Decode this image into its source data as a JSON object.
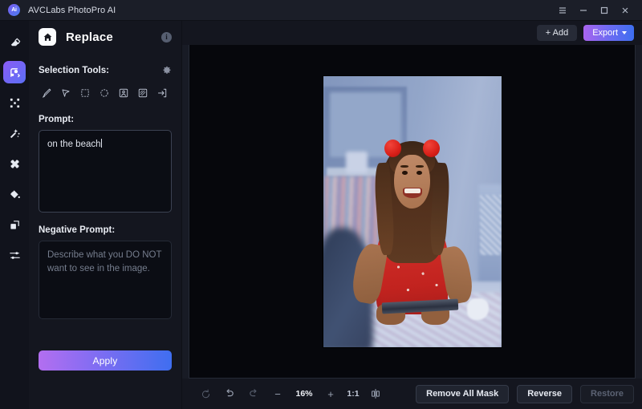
{
  "window": {
    "app_title": "AVCLabs PhotoPro AI",
    "logo_text": "Ai",
    "controls": [
      {
        "name": "menu",
        "glyph": "menu-icon"
      },
      {
        "name": "minimize",
        "glyph": "minimize-icon"
      },
      {
        "name": "maximize",
        "glyph": "maximize-icon"
      },
      {
        "name": "close",
        "glyph": "close-icon"
      }
    ]
  },
  "rail": {
    "items": [
      {
        "name": "eraser-tool",
        "icon": "eraser-icon",
        "active": false
      },
      {
        "name": "replace-tool",
        "icon": "replace-icon",
        "active": true
      },
      {
        "name": "expand-tool",
        "icon": "expand-icon",
        "active": false
      },
      {
        "name": "enhance-tool",
        "icon": "magic-wand-icon",
        "active": false
      },
      {
        "name": "retouch-tool",
        "icon": "retouch-icon",
        "active": false
      },
      {
        "name": "colorize-tool",
        "icon": "paint-bucket-icon",
        "active": false
      },
      {
        "name": "resize-tool",
        "icon": "resize-icon",
        "active": false
      },
      {
        "name": "adjust-tool",
        "icon": "sliders-icon",
        "active": false
      }
    ]
  },
  "panel": {
    "title": "Replace",
    "home_icon": "home-icon",
    "info_icon": "info-icon",
    "info_char": "i",
    "selection_tools_label": "Selection Tools:",
    "gear_icon": "gear-icon",
    "tools": [
      {
        "name": "brush-tool",
        "icon": "brush-icon"
      },
      {
        "name": "lasso-pointer-tool",
        "icon": "pointer-icon"
      },
      {
        "name": "rectangle-select-tool",
        "icon": "rectangle-select-icon"
      },
      {
        "name": "ellipse-select-tool",
        "icon": "ellipse-select-icon"
      },
      {
        "name": "subject-select-tool",
        "icon": "person-select-icon"
      },
      {
        "name": "background-select-tool",
        "icon": "background-select-icon"
      },
      {
        "name": "invert-select-tool",
        "icon": "arrow-into-box-icon"
      }
    ],
    "prompt_label": "Prompt:",
    "prompt_value": "on the beach",
    "negative_prompt_label": "Negative Prompt:",
    "negative_prompt_value": "",
    "negative_prompt_placeholder": "Describe what you DO NOT want to see in the image.",
    "apply_label": "Apply"
  },
  "topbar": {
    "add_label": "+ Add",
    "export_label": "Export",
    "export_chevron": "chevron-down-icon"
  },
  "bottombar": {
    "reset_icon": "reset-icon",
    "undo_icon": "undo-icon",
    "redo_icon": "redo-icon",
    "zoom_out_label": "−",
    "zoom_value": "16%",
    "zoom_in_label": "+",
    "actual_size_label": "1:1",
    "compare_icon": "compare-icon",
    "remove_all_mask_label": "Remove All Mask",
    "reverse_label": "Reverse",
    "restore_label": "Restore"
  },
  "colors": {
    "accent_start": "#a964ee",
    "accent_mid": "#6e6bf2",
    "accent_end": "#3d6ef0",
    "panel_bg": "#14161f",
    "canvas_bg": "#06070c",
    "titlebar_bg": "#1b1e28"
  }
}
